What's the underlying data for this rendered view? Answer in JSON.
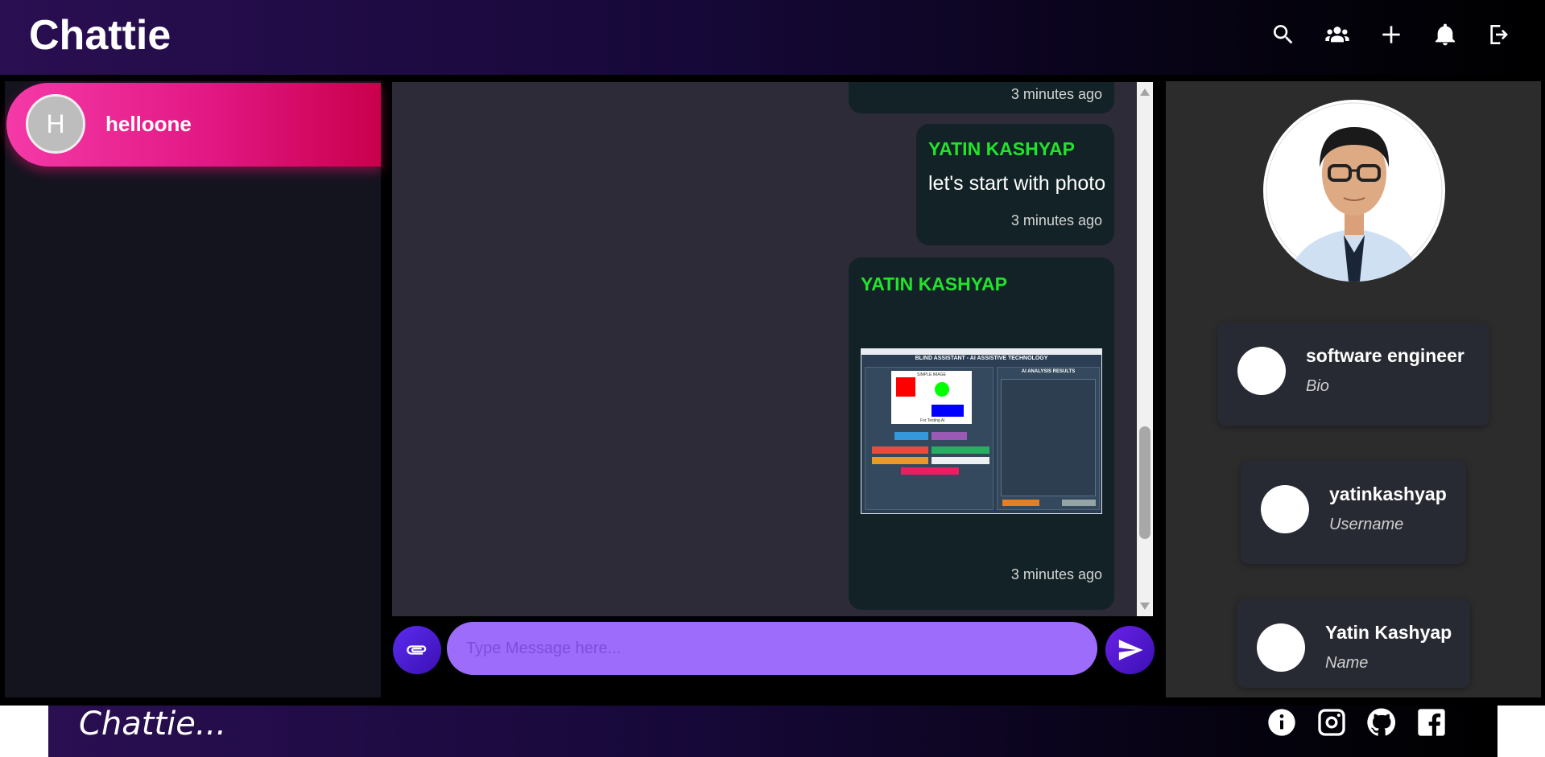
{
  "app": {
    "title": "Chattie",
    "footer_brand": "Chattie..."
  },
  "header_icons": [
    "search-icon",
    "group-icon",
    "plus-icon",
    "bell-icon",
    "logout-icon"
  ],
  "contacts": [
    {
      "initial": "H",
      "name": "helloone"
    }
  ],
  "messages": [
    {
      "sender": "",
      "text": "",
      "time": "3 minutes ago"
    },
    {
      "sender": "YATIN KASHYAP",
      "text": "let's start with photo",
      "time": "3 minutes ago"
    },
    {
      "sender": "YATIN KASHYAP",
      "text": "",
      "image_title": "BLIND ASSISTANT - AI ASSISTIVE TECHNOLOGY",
      "image_panel_title": "AI ANALYSIS RESULTS",
      "image_sample_label": "SIMPLE IMAGE",
      "image_caption": "For Testing AI",
      "time": "3 minutes ago"
    }
  ],
  "composer": {
    "placeholder": "Type Message here..."
  },
  "profile": {
    "bio": {
      "value": "software engineer",
      "label": "Bio"
    },
    "username": {
      "value": "yatinkashyap",
      "label": "Username"
    },
    "name": {
      "value": "Yatin Kashyap",
      "label": "Name"
    }
  },
  "footer_icons": [
    "info-icon",
    "instagram-icon",
    "github-icon",
    "facebook-icon"
  ],
  "colors": {
    "accent_pink": "#e21783",
    "sender_green": "#22e32b",
    "composer_purple": "#9e6cfb"
  }
}
